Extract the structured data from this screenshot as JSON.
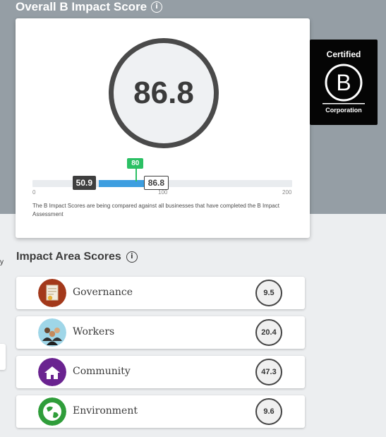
{
  "header": {
    "title": "Overall B Impact Score"
  },
  "overall": {
    "score": "86.8",
    "scale_min": 0,
    "scale_max": 200,
    "ticks": [
      "0",
      "100",
      "200"
    ],
    "median_value": 50.9,
    "median_label": "50.9",
    "score_value": 86.8,
    "score_badge": "86.8",
    "qualify_value": 80,
    "qualify_label": "80",
    "note": "The B Impact Scores are being compared against all businesses that have completed the B Impact Assessment"
  },
  "certified": {
    "top": "Certified",
    "letter": "B",
    "bottom": "Corporation"
  },
  "colors": {
    "header_band": "#959ea5",
    "bar_fill": "#3d9ee0",
    "qualify_marker": "#2bc064",
    "ring": "#4a4a4a"
  },
  "edge": {
    "letter": "y"
  },
  "impact_areas": {
    "title": "Impact Area Scores",
    "items": [
      {
        "label": "Governance",
        "score": "9.5",
        "icon": "governance-icon"
      },
      {
        "label": "Workers",
        "score": "20.4",
        "icon": "workers-icon"
      },
      {
        "label": "Community",
        "score": "47.3",
        "icon": "community-icon"
      },
      {
        "label": "Environment",
        "score": "9.6",
        "icon": "environment-icon"
      }
    ]
  }
}
